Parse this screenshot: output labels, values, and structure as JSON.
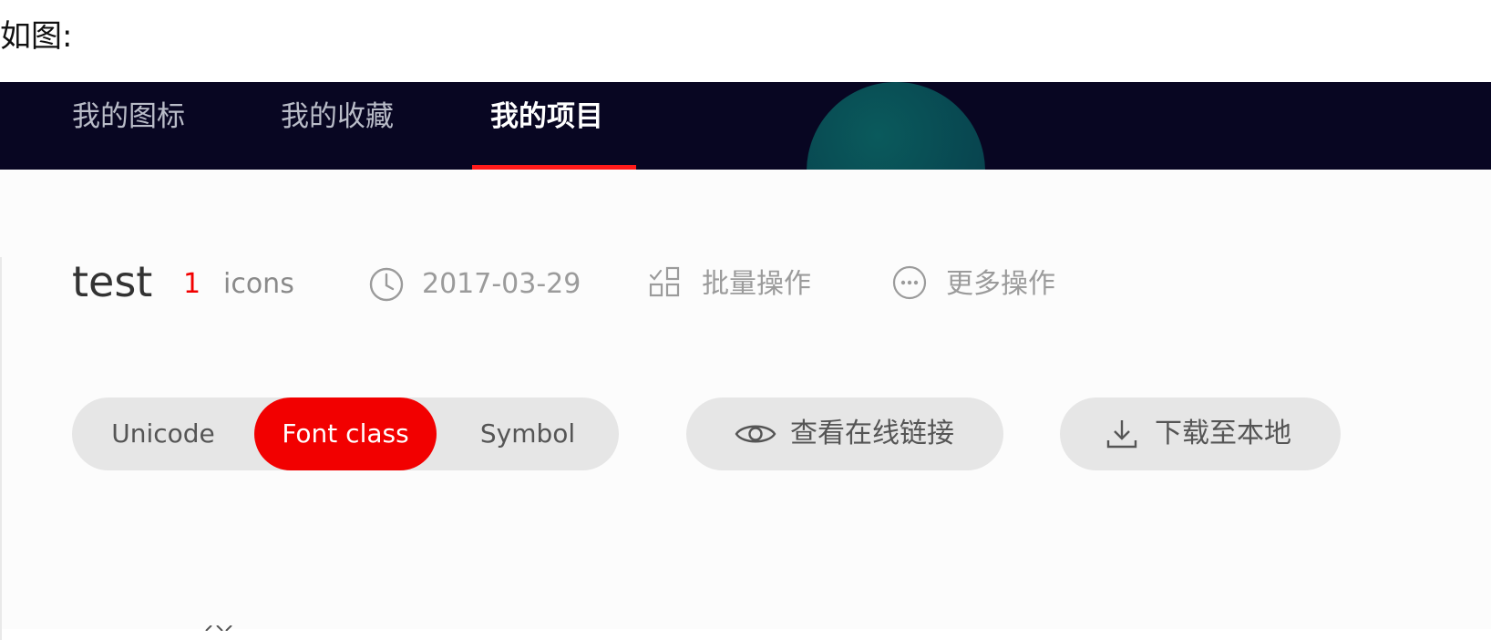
{
  "caption": "如图:",
  "nav": {
    "tabs": [
      {
        "label": "我的图标"
      },
      {
        "label": "我的收藏"
      },
      {
        "label": "我的项目"
      }
    ],
    "active_tab": "我的项目"
  },
  "project": {
    "name": "test",
    "count": "1",
    "count_label": "icons",
    "date": "2017-03-29",
    "batch_label": "批量操作",
    "more_label": "更多操作"
  },
  "format_toggle": {
    "options": [
      "Unicode",
      "Font class",
      "Symbol"
    ],
    "selected": "Font class"
  },
  "actions": {
    "view_online": "查看在线链接",
    "download": "下载至本地"
  },
  "colors": {
    "nav_bg": "#080622",
    "accent": "#f20000",
    "pill_bg": "#e6e6e6"
  },
  "icons": [
    "clock-icon",
    "grid-icon",
    "more-dots-icon",
    "eye-icon",
    "download-icon"
  ]
}
